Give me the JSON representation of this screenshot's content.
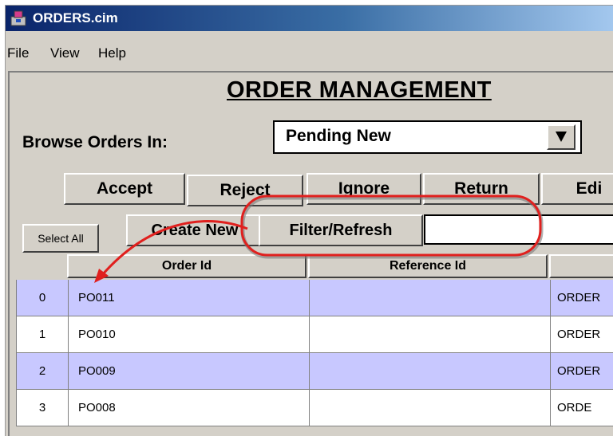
{
  "window": {
    "title": "ORDERS.cim",
    "icon": "app-icon"
  },
  "menu": {
    "items": [
      "File",
      "View",
      "Help"
    ]
  },
  "page": {
    "title": "ORDER MANAGEMENT"
  },
  "browse": {
    "label": "Browse Orders In:",
    "selected": "Pending New"
  },
  "actions": {
    "accept": "Accept",
    "reject": "Reject",
    "ignore": "Ignore",
    "return": "Return",
    "edit": "Edi"
  },
  "toolbar": {
    "select_all": "Select All",
    "create_new": "Create New",
    "filter_refresh": "Filter/Refresh",
    "filter_value": ""
  },
  "grid": {
    "columns": {
      "order_id": "Order Id",
      "reference_id": "Reference Id"
    },
    "rows": [
      {
        "index": "0",
        "order_id": "PO011",
        "reference_id": "",
        "status": "ORDER"
      },
      {
        "index": "1",
        "order_id": "PO010",
        "reference_id": "",
        "status": "ORDER"
      },
      {
        "index": "2",
        "order_id": "PO009",
        "reference_id": "",
        "status": "ORDER"
      },
      {
        "index": "3",
        "order_id": "PO008",
        "reference_id": "",
        "status": "ORDE"
      }
    ]
  },
  "colors": {
    "row_highlight": "#c8c8ff",
    "callout": "#e0201e",
    "titlebar": "#0a246a"
  }
}
